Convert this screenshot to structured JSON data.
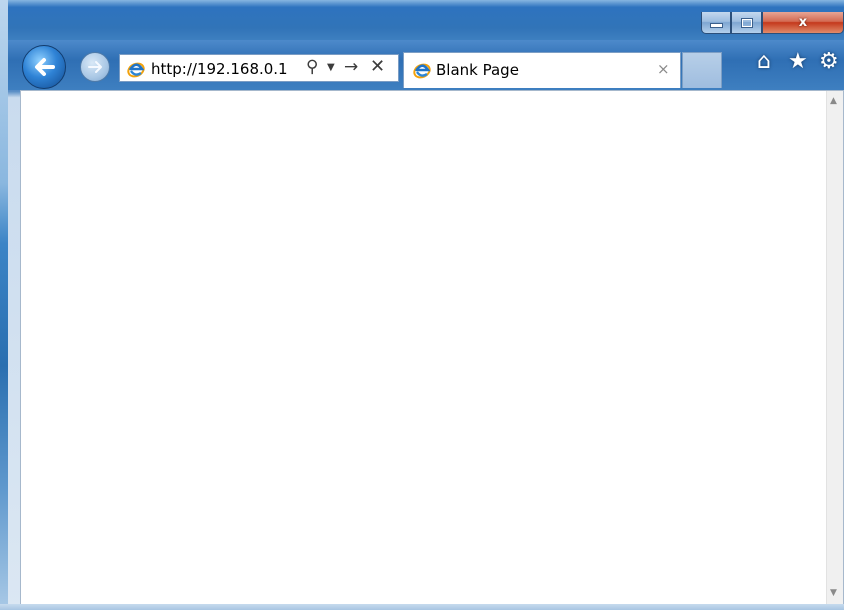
{
  "window": {
    "caption_buttons": {
      "minimize": "minimize",
      "maximize": "maximize",
      "close": "x"
    }
  },
  "navigation": {
    "back_icon": "back-arrow-icon",
    "forward_icon": "forward-arrow-icon"
  },
  "address_bar": {
    "url": "http://192.168.0.1",
    "icons": [
      "ie-icon",
      "search-icon",
      "dropdown-icon",
      "go-arrow-icon",
      "stop-icon"
    ]
  },
  "tab": {
    "title": "Blank Page",
    "close_glyph": "×"
  },
  "command_icons": [
    "home-icon",
    "favorites-star-icon",
    "tools-gear-icon"
  ],
  "colors": {
    "frame_blue": "#3174b8",
    "close_red": "#c4381c",
    "content_bg": "#ffffff"
  }
}
